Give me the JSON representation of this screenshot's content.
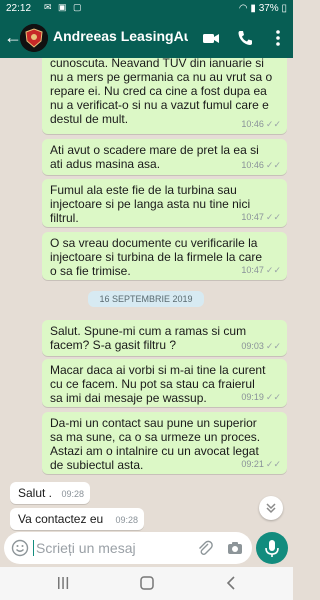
{
  "status_bar": {
    "time": "22:12",
    "battery": "37%"
  },
  "header": {
    "title": "Andreeas LeasingAuto..."
  },
  "messages": [
    {
      "text": "cunoscuta. Neavand TUV din ianuarie si\nnu a mers pe germania ca nu au vrut sa o\nrepare ei. Nu cred ca cine a fost dupa ea\nnu a verificat-o si nu a vazut fumul care e\ndestul de mult.",
      "time": "10:46"
    },
    {
      "text": "Ati avut o scadere mare de pret la ea si\nati adus masina asa.",
      "time": "10:46"
    },
    {
      "text": "Fumul ala este fie de la turbina sau\ninjectoare si pe langa asta nu tine nici\nfiltrul.",
      "time": "10:47"
    },
    {
      "text": "O sa vreau documente cu verificarile la\ninjectoare si turbina de la firmele la care\no sa fie trimise.",
      "time": "10:47"
    },
    {
      "text": "Salut. Spune-mi cum a ramas si cum\nfacem? S-a gasit filtru ?",
      "time": "09:03"
    },
    {
      "text": "Macar daca ai vorbi si m-ai tine la curent\ncu ce facem. Nu pot sa stau ca fraierul\nsa imi dai mesaje pe wassup.",
      "time": "09:19"
    },
    {
      "text": "Da-mi un contact sau pune un superior\nsa ma sune, ca o sa urmeze un proces.\nAstazi am o intalnire cu un avocat legat\nde subiectul asta.",
      "time": "09:21"
    },
    {
      "text": "Salut .",
      "time": "09:28"
    },
    {
      "text": "Va contactez eu",
      "time": "09:28"
    }
  ],
  "date_separator": "16 SEPTEMBRIE 2019",
  "composer": {
    "placeholder": "Scrieți un mesaj"
  },
  "colors": {
    "header": "#075e54",
    "outgoing_bubble": "#dcf8c6",
    "incoming_bubble": "#ffffff",
    "chat_bg": "#e5ddd5",
    "accent": "#128c7e"
  },
  "icons": [
    "back-arrow-icon",
    "video-call-icon",
    "phone-icon",
    "more-options-icon",
    "emoji-icon",
    "attach-icon",
    "camera-icon",
    "microphone-icon",
    "scroll-down-icon"
  ]
}
